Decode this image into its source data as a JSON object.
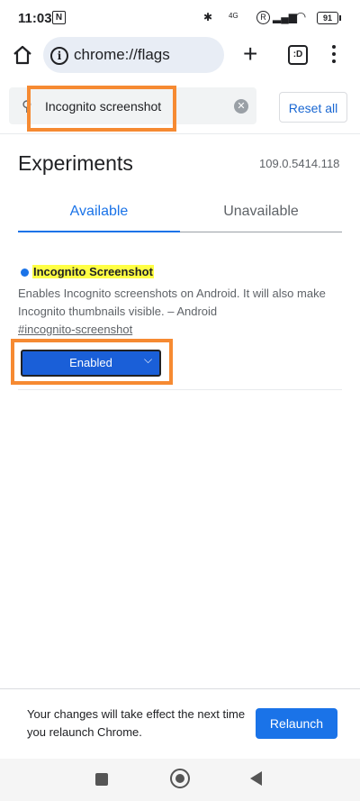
{
  "status_bar": {
    "time": "11:03",
    "nfc": "N",
    "network": "4G",
    "battery": "91"
  },
  "toolbar": {
    "url": "chrome://flags",
    "tab_count": ":D"
  },
  "search": {
    "value": "Incognito screenshot",
    "reset_label": "Reset all"
  },
  "experiments": {
    "title": "Experiments",
    "version": "109.0.5414.118",
    "tabs": [
      {
        "label": "Available"
      },
      {
        "label": "Unavailable"
      }
    ]
  },
  "flag": {
    "name": "Incognito Screenshot",
    "description": "Enables Incognito screenshots on Android. It will also make Incognito thumbnails visible. – Android",
    "link": "#incognito-screenshot",
    "selected": "Enabled"
  },
  "relaunch": {
    "message": "Your changes will take effect the next time you relaunch Chrome.",
    "button": "Relaunch"
  },
  "colors": {
    "accent": "#1a73e8",
    "highlight": "#f68a32",
    "name_highlight": "#ffff44"
  }
}
